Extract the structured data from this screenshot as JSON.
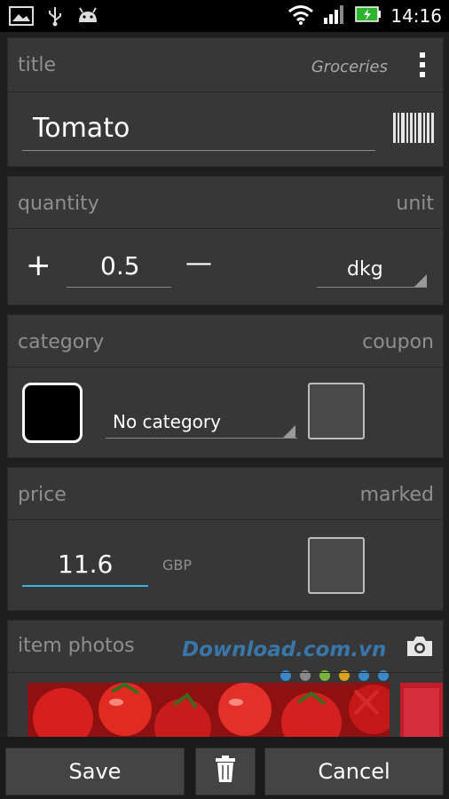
{
  "status_bar": {
    "time": "14:16"
  },
  "title_section": {
    "label": "title",
    "list_name": "Groceries",
    "item_name": "Tomato"
  },
  "quantity_section": {
    "label": "quantity",
    "unit_label": "unit",
    "value": "0.5",
    "plus": "+",
    "minus": "—",
    "unit_value": "dkg"
  },
  "category_section": {
    "label": "category",
    "coupon_label": "coupon",
    "category_value": "No category"
  },
  "price_section": {
    "label": "price",
    "marked_label": "marked",
    "value": "11.6",
    "currency": "GBP"
  },
  "photos_section": {
    "label": "item photos",
    "watermark": "Download.com.vn"
  },
  "bottom_bar": {
    "save": "Save",
    "cancel": "Cancel"
  }
}
